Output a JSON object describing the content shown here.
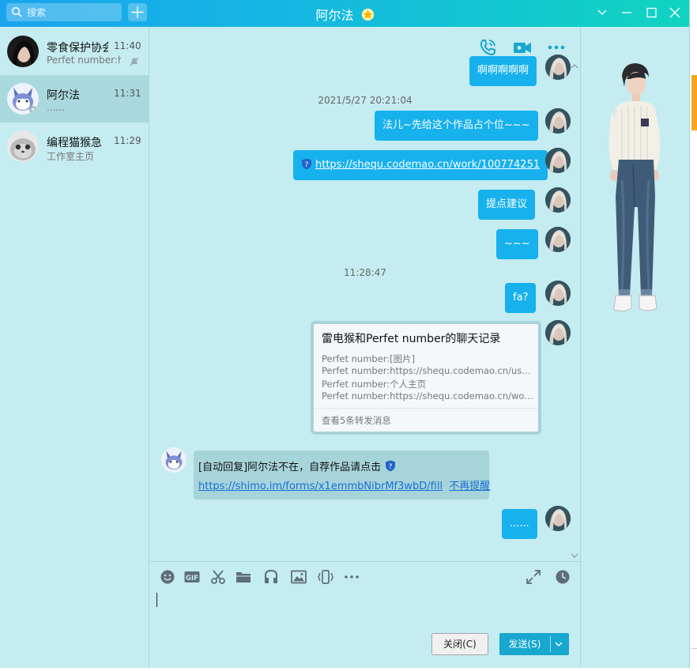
{
  "window": {
    "title": "阿尔法",
    "search_placeholder": "搜索",
    "accent": "#17b1ed"
  },
  "conversations": [
    {
      "name": "零食保护协会",
      "time": "11:40",
      "preview": "Perfet number:h",
      "muted": true
    },
    {
      "name": "阿尔法",
      "time": "11:31",
      "preview": "......",
      "selected": true
    },
    {
      "name": "编程猫猴急",
      "time": "11:29",
      "preview": "工作室主页"
    }
  ],
  "messages": {
    "m0": "啊啊啊啊啊",
    "ts1": "2021/5/27 20:21:04",
    "m1": "法儿~先给这个作品占个位~~~",
    "m2_link": "https://shequ.codemao.cn/work/100774251",
    "m3": "提点建议",
    "m4": "~~~",
    "ts2": "11:28:47",
    "m5": "fa?",
    "forward": {
      "title": "雷电猴和Perfet number的聊天记录",
      "lines": [
        "Perfet number:[图片]",
        "Perfet number:https://shequ.codemao.cn/user/...",
        "Perfet number:个人主页",
        "Perfet number:https://shequ.codemao.cn/work/..."
      ],
      "footer": "查看5条转发消息"
    },
    "auto_reply": {
      "text": "[自动回复]阿尔法不在，自荐作品请点击",
      "link": "https://shimo.im/forms/x1emmbNibrMf3wbD/fill",
      "stop": "不再提醒"
    },
    "m6": "......"
  },
  "icons": {
    "chat_toolbar": [
      "phone-icon",
      "video-icon",
      "more-icon"
    ],
    "input_toolbar": [
      "emoji-icon",
      "gif-icon",
      "scissors-icon",
      "folder-icon",
      "music-icon",
      "image-icon",
      "shake-icon",
      "more-icon",
      "expand-icon",
      "history-icon"
    ]
  },
  "buttons": {
    "close": "关闭(C)",
    "send": "发送(S)"
  }
}
